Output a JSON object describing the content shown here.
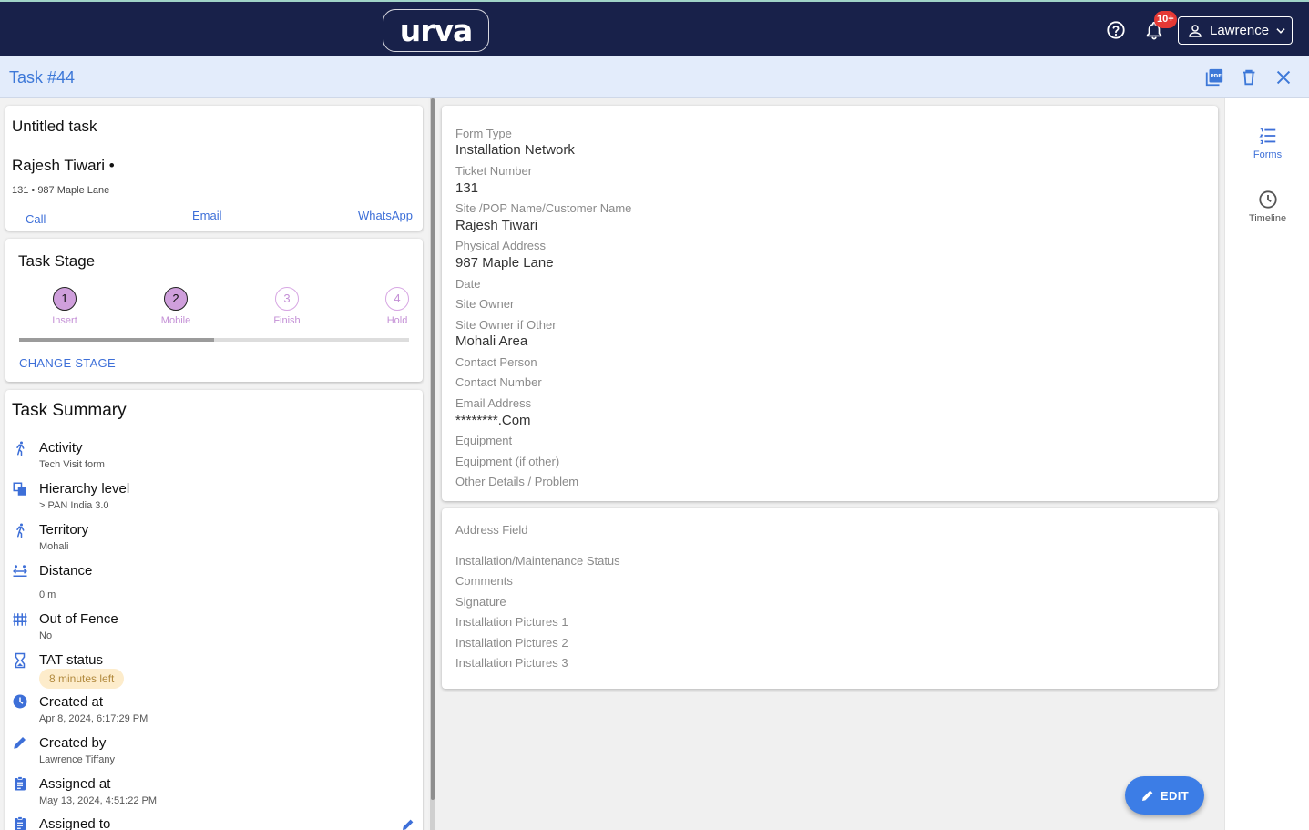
{
  "topbar": {
    "logo_text": "urva",
    "notification_count": "10+",
    "user_name": "Lawrence"
  },
  "taskbar": {
    "title": "Task #44",
    "actions": [
      "pdf-icon",
      "delete-icon",
      "close-icon"
    ]
  },
  "contact": {
    "task_name": "Untitled task",
    "customer_name": "Rajesh Tiwari •",
    "address": "131 • 987 Maple Lane",
    "call_label": "Call",
    "email_label": "Email",
    "whatsapp_label": "WhatsApp"
  },
  "stage": {
    "title": "Task Stage",
    "steps": [
      {
        "number": "1",
        "label": "Insert",
        "done": true
      },
      {
        "number": "2",
        "label": "Mobile",
        "done": true
      },
      {
        "number": "3",
        "label": "Finish",
        "done": false
      },
      {
        "number": "4",
        "label": "Hold",
        "done": false
      }
    ],
    "progress_fraction": 0.5,
    "change_label": "CHANGE STAGE"
  },
  "summary": {
    "title": "Task Summary",
    "items": [
      {
        "label": "Activity",
        "value": "Tech Visit form",
        "icon": "run-icon"
      },
      {
        "label": "Hierarchy level",
        "value": "> PAN India 3.0",
        "icon": "layers-icon"
      },
      {
        "label": "Territory",
        "value": "Mohali",
        "icon": "run-icon"
      },
      {
        "label": "Distance",
        "value": "0 m",
        "icon": "distance-icon"
      },
      {
        "label": "Out of Fence",
        "value": "No",
        "icon": "fence-icon"
      },
      {
        "label": "TAT status",
        "value": "8 minutes left",
        "icon": "hourglass-icon"
      },
      {
        "label": "Created at",
        "value": "Apr 8, 2024, 6:17:29 PM",
        "icon": "clock-icon"
      },
      {
        "label": "Created by",
        "value": "Lawrence Tiffany",
        "icon": "pencil-icon"
      },
      {
        "label": "Assigned at",
        "value": "May 13, 2024, 4:51:22 PM",
        "icon": "clipboard-icon"
      },
      {
        "label": "Assigned to",
        "value": "",
        "icon": "clipboard-icon"
      }
    ]
  },
  "form1": [
    {
      "label": "Form Type",
      "value": "Installation Network"
    },
    {
      "label": "Ticket Number",
      "value": "131"
    },
    {
      "label": "Site /POP Name/Customer Name",
      "value": "Rajesh Tiwari"
    },
    {
      "label": "Physical Address",
      "value": "987 Maple Lane"
    },
    {
      "label": "Date",
      "value": ""
    },
    {
      "label": "Site Owner",
      "value": ""
    },
    {
      "label": "Site Owner if Other",
      "value": "Mohali Area"
    },
    {
      "label": "Contact Person",
      "value": ""
    },
    {
      "label": "Contact Number",
      "value": ""
    },
    {
      "label": "Email Address",
      "value": "********.Com"
    },
    {
      "label": "Equipment",
      "value": ""
    },
    {
      "label": "Equipment (if other)",
      "value": ""
    },
    {
      "label": "Other Details / Problem",
      "value": ""
    }
  ],
  "form2": [
    {
      "label": "Address Field"
    },
    {
      "label": "Installation/Maintenance Status"
    },
    {
      "label": "Comments"
    },
    {
      "label": "Signature"
    },
    {
      "label": "Installation Pictures 1"
    },
    {
      "label": "Installation Pictures 2"
    },
    {
      "label": "Installation Pictures 3"
    }
  ],
  "rail": {
    "forms_label": "Forms",
    "timeline_label": "Timeline"
  },
  "fab": {
    "label": "EDIT"
  },
  "colors": {
    "topbar": "#18214a",
    "accent": "#3c7de6",
    "stage_done": "#cf9fdc",
    "stage_label": "#c490d6"
  }
}
